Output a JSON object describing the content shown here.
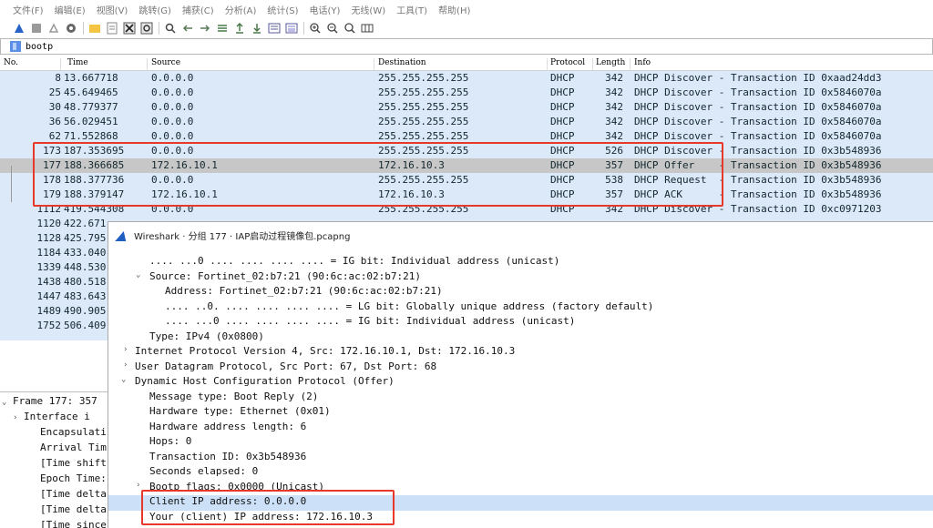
{
  "menubar": {
    "items": [
      "文件(F)",
      "编辑(E)",
      "视图(V)",
      "跳转(G)",
      "捕获(C)",
      "分析(A)",
      "统计(S)",
      "电话(Y)",
      "无线(W)",
      "工具(T)",
      "帮助(H)"
    ]
  },
  "toolbar": {
    "icons": [
      "shark-fin-icon",
      "stop-icon",
      "restart-icon",
      "options-icon",
      "open-icon",
      "save-icon",
      "close-file-icon",
      "reload-icon",
      "find-icon",
      "back-icon",
      "forward-icon",
      "goto-icon",
      "first-icon",
      "last-icon",
      "autoscroll-icon",
      "colorize-icon",
      "zoom-in-icon",
      "zoom-out-icon",
      "zoom-reset-icon",
      "resize-columns-icon"
    ]
  },
  "filter": {
    "value": "bootp"
  },
  "columns": [
    "No.",
    "Time",
    "Source",
    "Destination",
    "Protocol",
    "Length",
    "Info"
  ],
  "packets": [
    {
      "no": "8",
      "time": "13.667718",
      "src": "0.0.0.0",
      "dst": "255.255.255.255",
      "proto": "DHCP",
      "len": "342",
      "info": "DHCP Discover - Transaction ID 0xaad24dd3"
    },
    {
      "no": "25",
      "time": "45.649465",
      "src": "0.0.0.0",
      "dst": "255.255.255.255",
      "proto": "DHCP",
      "len": "342",
      "info": "DHCP Discover - Transaction ID 0x5846070a"
    },
    {
      "no": "30",
      "time": "48.779377",
      "src": "0.0.0.0",
      "dst": "255.255.255.255",
      "proto": "DHCP",
      "len": "342",
      "info": "DHCP Discover - Transaction ID 0x5846070a"
    },
    {
      "no": "36",
      "time": "56.029451",
      "src": "0.0.0.0",
      "dst": "255.255.255.255",
      "proto": "DHCP",
      "len": "342",
      "info": "DHCP Discover - Transaction ID 0x5846070a"
    },
    {
      "no": "62",
      "time": "71.552868",
      "src": "0.0.0.0",
      "dst": "255.255.255.255",
      "proto": "DHCP",
      "len": "342",
      "info": "DHCP Discover - Transaction ID 0x5846070a"
    },
    {
      "no": "173",
      "time": "187.353695",
      "src": "0.0.0.0",
      "dst": "255.255.255.255",
      "proto": "DHCP",
      "len": "526",
      "info": "DHCP Discover - Transaction ID 0x3b548936"
    },
    {
      "no": "177",
      "time": "188.366685",
      "src": "172.16.10.1",
      "dst": "172.16.10.3",
      "proto": "DHCP",
      "len": "357",
      "info": "DHCP Offer    - Transaction ID 0x3b548936"
    },
    {
      "no": "178",
      "time": "188.377736",
      "src": "0.0.0.0",
      "dst": "255.255.255.255",
      "proto": "DHCP",
      "len": "538",
      "info": "DHCP Request  - Transaction ID 0x3b548936"
    },
    {
      "no": "179",
      "time": "188.379147",
      "src": "172.16.10.1",
      "dst": "172.16.10.3",
      "proto": "DHCP",
      "len": "357",
      "info": "DHCP ACK      - Transaction ID 0x3b548936"
    },
    {
      "no": "1112",
      "time": "419.544308",
      "src": "0.0.0.0",
      "dst": "255.255.255.255",
      "proto": "DHCP",
      "len": "342",
      "info": "DHCP Discover - Transaction ID 0xc0971203"
    },
    {
      "no": "1120",
      "time": "422.671"
    },
    {
      "no": "1128",
      "time": "425.795"
    },
    {
      "no": "1184",
      "time": "433.040"
    },
    {
      "no": "1339",
      "time": "448.530"
    },
    {
      "no": "1438",
      "time": "480.518"
    },
    {
      "no": "1447",
      "time": "483.643"
    },
    {
      "no": "1489",
      "time": "490.905"
    },
    {
      "no": "1752",
      "time": "506.409"
    }
  ],
  "detail_left": [
    "Frame 177: 357",
    "Interface i",
    "Encapsulati",
    "Arrival Tim",
    "[Time shift",
    "Epoch Time:",
    "[Time delta",
    "[Time delta",
    "[Time since"
  ],
  "popup": {
    "title": "Wireshark · 分组 177 · IAP启动过程镜像包.pcapng",
    "lines": [
      ".... ...0 .... .... .... .... = IG bit: Individual address (unicast)",
      "Source: Fortinet_02:b7:21 (90:6c:ac:02:b7:21)",
      "Address: Fortinet_02:b7:21 (90:6c:ac:02:b7:21)",
      ".... ..0. .... .... .... .... = LG bit: Globally unique address (factory default)",
      ".... ...0 .... .... .... .... = IG bit: Individual address (unicast)",
      "Type: IPv4 (0x0800)",
      "Internet Protocol Version 4, Src: 172.16.10.1, Dst: 172.16.10.3",
      "User Datagram Protocol, Src Port: 67, Dst Port: 68",
      "Dynamic Host Configuration Protocol (Offer)",
      "Message type: Boot Reply (2)",
      "Hardware type: Ethernet (0x01)",
      "Hardware address length: 6",
      "Hops: 0",
      "Transaction ID: 0x3b548936",
      "Seconds elapsed: 0",
      "Bootp flags: 0x0000 (Unicast)",
      "Client IP address: 0.0.0.0",
      "Your (client) IP address: 172.16.10.3"
    ]
  },
  "colors": {
    "row_bg": "#dce9f9",
    "selected": "#c7c7c7",
    "highlight": "#cce1f7",
    "annotation": "#e8382c"
  }
}
